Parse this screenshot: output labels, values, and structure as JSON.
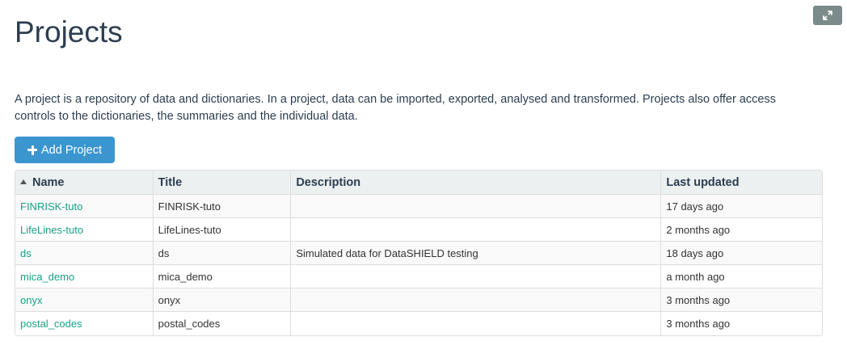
{
  "header": {
    "title": "Projects",
    "expand_icon": "expand-icon"
  },
  "intro": "A project is a repository of data and dictionaries. In a project, data can be imported, exported, analysed and transformed. Projects also offer access controls to the dictionaries, the summaries and the individual data.",
  "toolbar": {
    "add_label": "Add Project",
    "add_icon": "plus-icon"
  },
  "table": {
    "sort_icon": "sort-ascending-icon",
    "columns": {
      "name": "Name",
      "title": "Title",
      "description": "Description",
      "last_updated": "Last updated"
    },
    "rows": [
      {
        "name": "FINRISK-tuto",
        "title": "FINRISK-tuto",
        "description": "",
        "last_updated": "17 days ago"
      },
      {
        "name": "LifeLines-tuto",
        "title": "LifeLines-tuto",
        "description": "",
        "last_updated": "2 months ago"
      },
      {
        "name": "ds",
        "title": "ds",
        "description": "Simulated data for DataSHIELD testing",
        "last_updated": "18 days ago"
      },
      {
        "name": "mica_demo",
        "title": "mica_demo",
        "description": "",
        "last_updated": "a month ago"
      },
      {
        "name": "onyx",
        "title": "onyx",
        "description": "",
        "last_updated": "3 months ago"
      },
      {
        "name": "postal_codes",
        "title": "postal_codes",
        "description": "",
        "last_updated": "3 months ago"
      }
    ]
  },
  "colors": {
    "heading": "#2c3e50",
    "link": "#18a085",
    "primary_button": "#3b95cf",
    "expand_button": "#7b8a8b",
    "header_bg": "#ecf0f1"
  }
}
